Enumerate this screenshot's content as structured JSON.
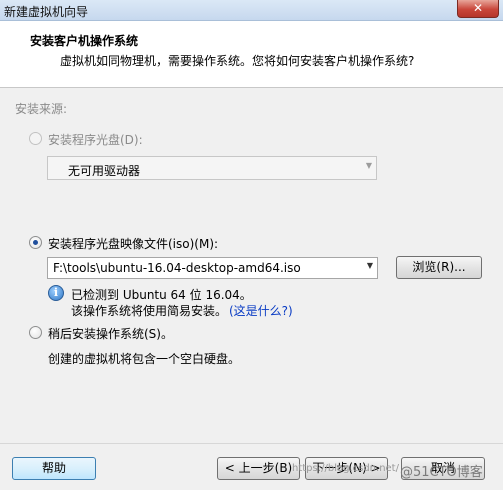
{
  "window": {
    "title": "新建虚拟机向导"
  },
  "header": {
    "title": "安装客户机操作系统",
    "subtitle": "虚拟机如同物理机，需要操作系统。您将如何安装客户机操作系统?"
  },
  "source": {
    "label": "安装来源:",
    "disc": {
      "label": "安装程序光盘(D):",
      "selected": false,
      "enabled": false,
      "combo_value": "无可用驱动器"
    },
    "iso": {
      "label": "安装程序光盘映像文件(iso)(M):",
      "selected": true,
      "enabled": true,
      "combo_value": "F:\\tools\\ubuntu-16.04-desktop-amd64.iso",
      "browse_label": "浏览(R)..."
    },
    "detect": {
      "line1": "已检测到 Ubuntu 64 位 16.04。",
      "line2": "该操作系统将使用简易安装。",
      "link": "(这是什么?)"
    },
    "later": {
      "label": "稍后安装操作系统(S)。",
      "selected": false,
      "description": "创建的虚拟机将包含一个空白硬盘。"
    }
  },
  "footer": {
    "help_label": "帮助",
    "back_label": "< 上一步(B)",
    "next_label": "下一步(N) >",
    "cancel_label": "取消"
  },
  "watermark": {
    "left": "https://blog.csdn.net/",
    "right": "@51CTO博客"
  },
  "colors": {
    "link": "#0a3cc4",
    "radio_dot": "#1f4e9c",
    "header_bg": "#ffffff",
    "window_bg": "#f0f0f0"
  },
  "icons": {
    "info": "info-icon",
    "dropdown": "chevron-down-icon"
  }
}
